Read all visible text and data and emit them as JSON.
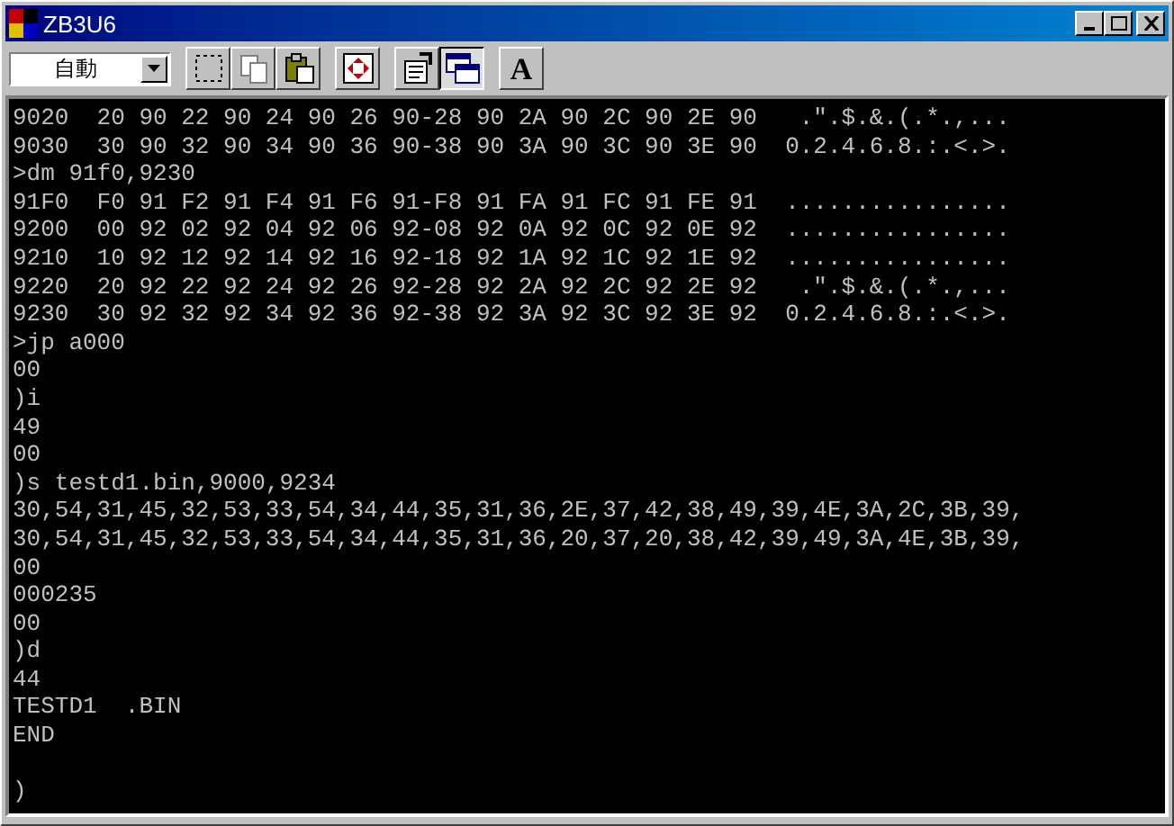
{
  "window": {
    "title": "ZB3U6"
  },
  "toolbar": {
    "font_size": "自動",
    "buttons": [
      {
        "kind": "mark",
        "pressed": false
      },
      {
        "kind": "copy",
        "pressed": false
      },
      {
        "kind": "paste",
        "pressed": false
      },
      {
        "kind": "fullscreen",
        "pressed": false
      },
      {
        "kind": "properties",
        "pressed": false
      },
      {
        "kind": "background",
        "pressed": true
      },
      {
        "kind": "font",
        "label": "A",
        "pressed": false
      }
    ]
  },
  "console_lines": [
    "9020  20 90 22 90 24 90 26 90-28 90 2A 90 2C 90 2E 90   .\".$.&.(.*.,...",
    "9030  30 90 32 90 34 90 36 90-38 90 3A 90 3C 90 3E 90  0.2.4.6.8.:.<.>.",
    ">dm 91f0,9230",
    "91F0  F0 91 F2 91 F4 91 F6 91-F8 91 FA 91 FC 91 FE 91  ................",
    "9200  00 92 02 92 04 92 06 92-08 92 0A 92 0C 92 0E 92  ................",
    "9210  10 92 12 92 14 92 16 92-18 92 1A 92 1C 92 1E 92  ................",
    "9220  20 92 22 92 24 92 26 92-28 92 2A 92 2C 92 2E 92   .\".$.&.(.*.,...",
    "9230  30 92 32 92 34 92 36 92-38 92 3A 92 3C 92 3E 92  0.2.4.6.8.:.<.>.",
    ">jp a000",
    "00",
    ")i",
    "49",
    "00",
    ")s testd1.bin,9000,9234",
    "30,54,31,45,32,53,33,54,34,44,35,31,36,2E,37,42,38,49,39,4E,3A,2C,3B,39,",
    "30,54,31,45,32,53,33,54,34,44,35,31,36,20,37,20,38,42,39,49,3A,4E,3B,39,",
    "00",
    "000235",
    "00",
    ")d",
    "44",
    "TESTD1  .BIN",
    "END",
    {
      "kind": "blank"
    },
    ")"
  ]
}
